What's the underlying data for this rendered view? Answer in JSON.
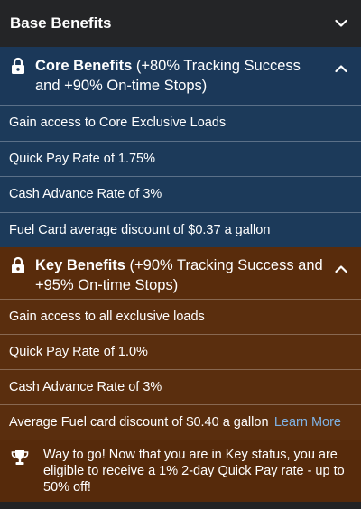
{
  "header": {
    "title": "Base Benefits",
    "chevron_icon": "chevron-down-icon"
  },
  "core": {
    "title": "Core Benefits",
    "subtitle": " (+80% Tracking Success and +90% On-time Stops)",
    "color": "#1c3a5a",
    "items": [
      "Gain access to Core Exclusive Loads",
      "Quick Pay Rate of 1.75%",
      "Cash Advance Rate of 3%",
      "Fuel Card average discount of $0.37 a gallon"
    ]
  },
  "key": {
    "title": "Key Benefits",
    "subtitle": " (+90% Tracking Success and +95% On-time Stops)",
    "color": "#5a2e0e",
    "items": [
      "Gain access to all exclusive loads",
      "Quick Pay Rate of 1.0%",
      "Cash Advance Rate of 3%",
      "Average Fuel card discount of $0.40 a gallon"
    ],
    "learn_more": "Learn More",
    "link_color": "#7fb2e3"
  },
  "footer": {
    "message": "Way to go! Now that you are in Key status, you are eligible to receive a 1% 2-day Quick Pay rate - up to 50% off!",
    "icon": "trophy-icon"
  }
}
